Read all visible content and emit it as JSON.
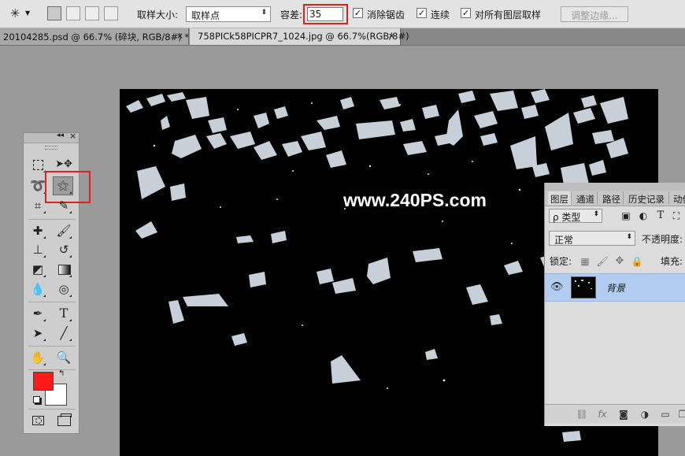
{
  "options_bar": {
    "sample_size_label": "取样大小:",
    "sample_size_value": "取样点",
    "tolerance_label": "容差:",
    "tolerance_value": "35",
    "antialias_label": "消除锯齿",
    "contiguous_label": "连续",
    "sample_all_label": "对所有图层取样",
    "refine_edge_label": "调整边缘...",
    "highlight_color": "#e02020"
  },
  "tabs": [
    {
      "label": "20104285.psd @ 66.7% (碎块, RGB/8#) *",
      "close": "×"
    },
    {
      "label": "758PICk58PICPR7_1024.jpg @ 66.7%(RGB/8#)",
      "close": "×"
    }
  ],
  "toolbox": {
    "collapse_label": "◂◂",
    "close_label": "×",
    "foreground_color": "#ff1a1a",
    "background_color": "#ffffff",
    "tools": [
      "rectangular-marquee",
      "move",
      "lasso",
      "magic-wand",
      "crop",
      "eyedropper",
      "healing-brush",
      "brush",
      "clone-stamp",
      "history-brush",
      "eraser",
      "gradient",
      "blur",
      "dodge",
      "pen",
      "type",
      "path-selection",
      "line",
      "hand",
      "zoom"
    ]
  },
  "canvas": {
    "watermark": "www.240PS.com"
  },
  "layers_panel": {
    "tabs": [
      "图层",
      "通道",
      "路径",
      "历史记录",
      "动作"
    ],
    "filter_kind": "ρ 类型",
    "blend_mode": "正常",
    "opacity_label": "不透明度:",
    "lock_label": "锁定:",
    "fill_label": "填充:",
    "layer_name": "背景",
    "footer_icons": [
      "link-icon",
      "fx-icon",
      "mask-icon",
      "adjustment-icon",
      "folder-icon"
    ]
  }
}
